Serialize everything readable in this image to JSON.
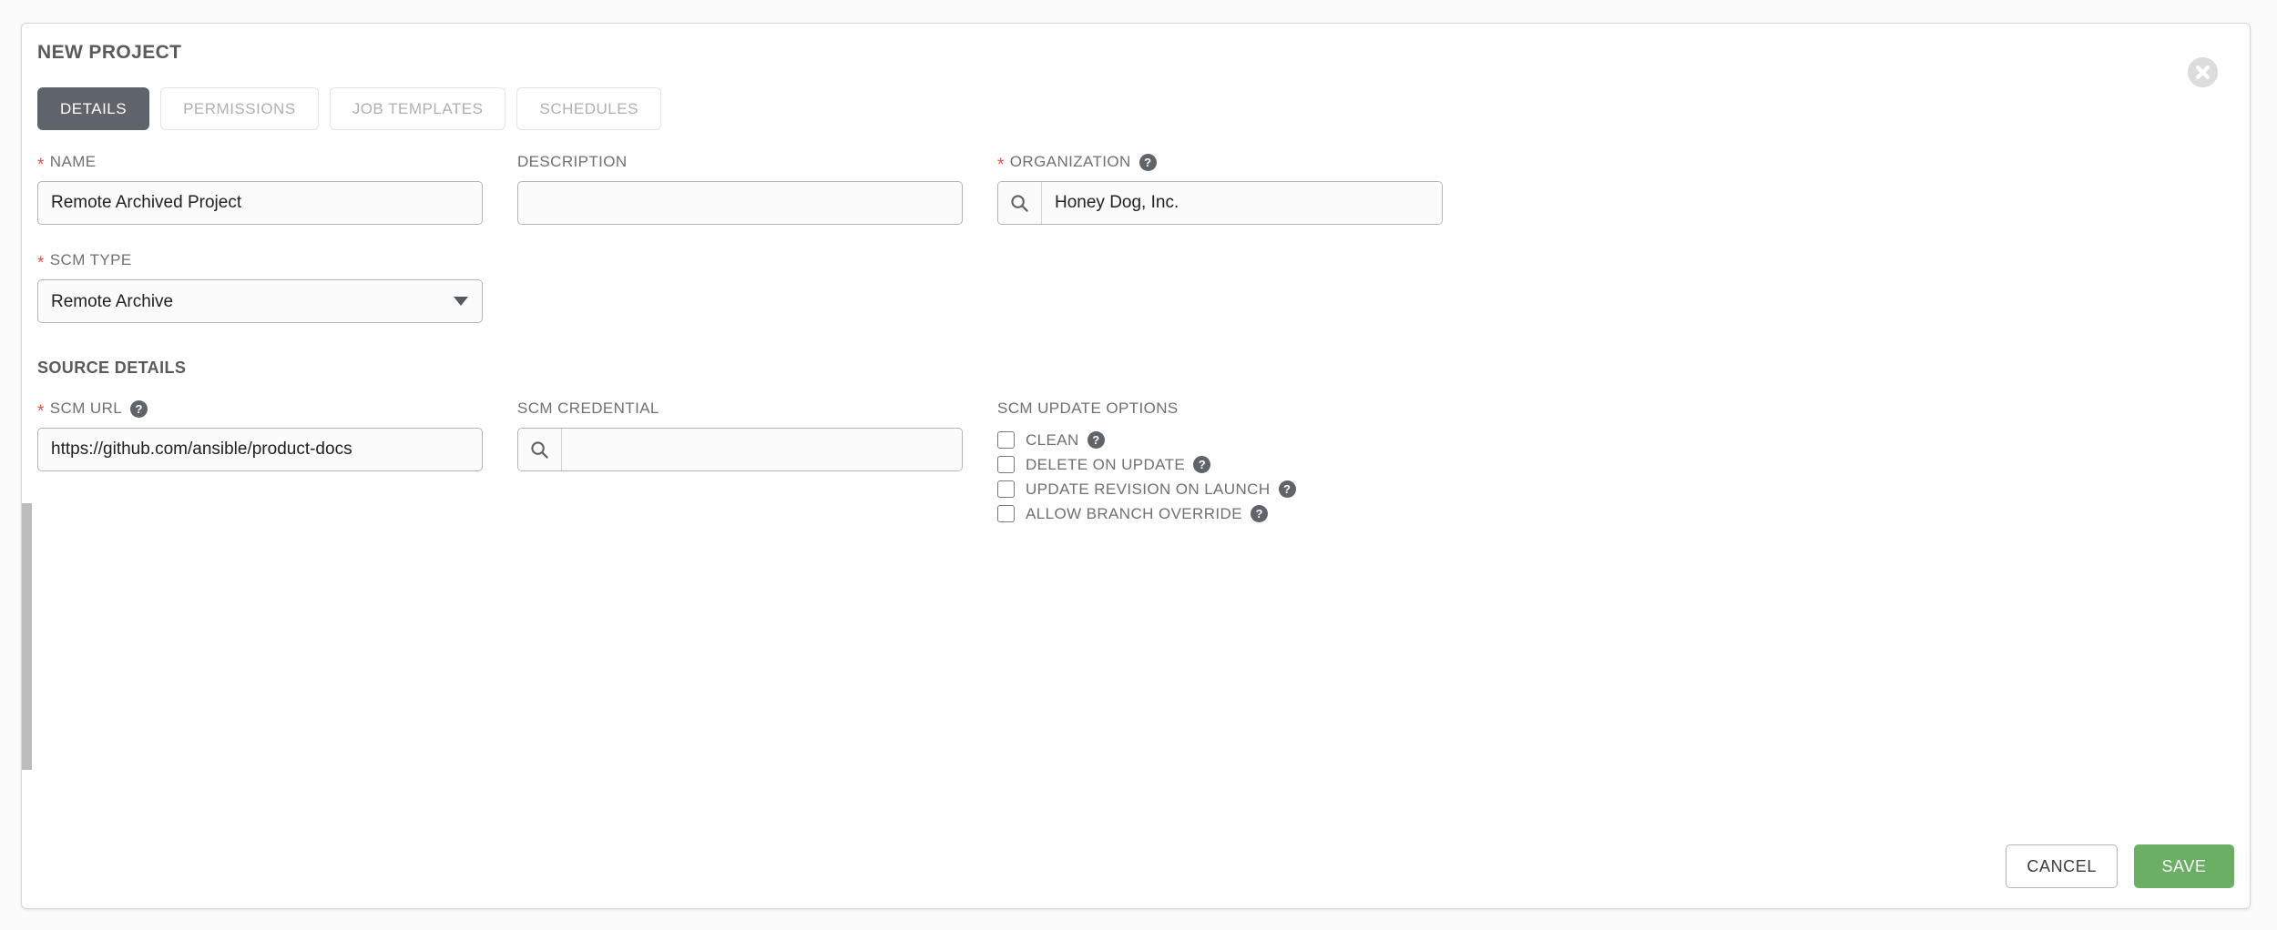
{
  "panel": {
    "title": "NEW PROJECT",
    "close_icon": "close-circle-icon"
  },
  "tabs": [
    {
      "label": "DETAILS",
      "active": true
    },
    {
      "label": "PERMISSIONS",
      "active": false
    },
    {
      "label": "JOB TEMPLATES",
      "active": false
    },
    {
      "label": "SCHEDULES",
      "active": false
    }
  ],
  "fields": {
    "name": {
      "label": "NAME",
      "required": true,
      "value": "Remote Archived Project",
      "placeholder": ""
    },
    "description": {
      "label": "DESCRIPTION",
      "required": false,
      "value": "",
      "placeholder": ""
    },
    "organization": {
      "label": "ORGANIZATION",
      "required": true,
      "value": "Honey Dog, Inc.",
      "placeholder": "",
      "help_icon": "question-circle-icon",
      "search_icon": "search-icon"
    },
    "scm_type": {
      "label": "SCM TYPE",
      "required": true,
      "value": "Remote Archive",
      "options": [
        "Remote Archive"
      ],
      "caret_icon": "chevron-down-icon"
    },
    "scm_url": {
      "label": "SCM URL",
      "required": true,
      "value": "https://github.com/ansible/product-docs",
      "placeholder": "",
      "help_icon": "question-circle-icon"
    },
    "scm_credential": {
      "label": "SCM CREDENTIAL",
      "required": false,
      "value": "",
      "placeholder": "",
      "search_icon": "search-icon"
    }
  },
  "source_details": {
    "title": "SOURCE DETAILS"
  },
  "scm_update_options": {
    "title": "SCM UPDATE OPTIONS",
    "items": [
      {
        "label": "CLEAN",
        "checked": false,
        "help_icon": "question-circle-icon"
      },
      {
        "label": "DELETE ON UPDATE",
        "checked": false,
        "help_icon": "question-circle-icon"
      },
      {
        "label": "UPDATE REVISION ON LAUNCH",
        "checked": false,
        "help_icon": "question-circle-icon"
      },
      {
        "label": "ALLOW BRANCH OVERRIDE",
        "checked": false,
        "help_icon": "question-circle-icon"
      }
    ]
  },
  "footer": {
    "cancel_label": "CANCEL",
    "save_label": "SAVE"
  },
  "colors": {
    "accent_active_tab": "#5f646b",
    "save_green": "#6aaf63",
    "required_red": "#d9534f",
    "label_gray": "#707070",
    "scrollbar": "#bcbcbc"
  }
}
